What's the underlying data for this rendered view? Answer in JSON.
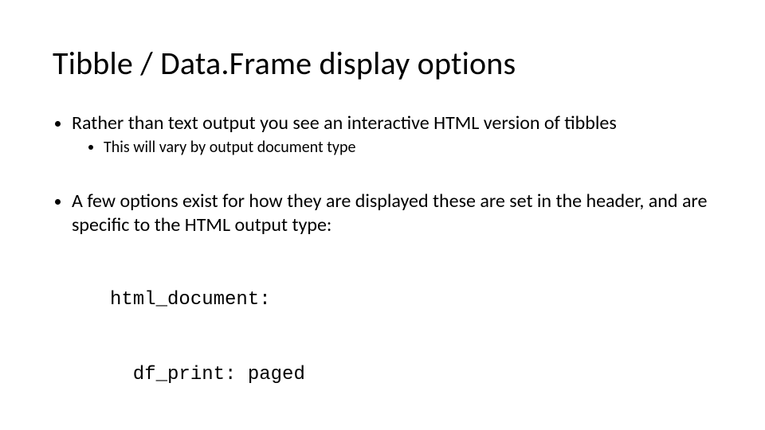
{
  "slide": {
    "title": "Tibble / Data.Frame display options",
    "bullets": {
      "item1": "Rather than text output you see an interactive HTML version of tibbles",
      "item1_sub1": "This will vary by output document type",
      "item2": "A few options exist for how they are displayed these are set in the header, and are specific to the HTML output type:",
      "code_line1": "html_document:",
      "code_line2": "  df_print: paged"
    }
  }
}
